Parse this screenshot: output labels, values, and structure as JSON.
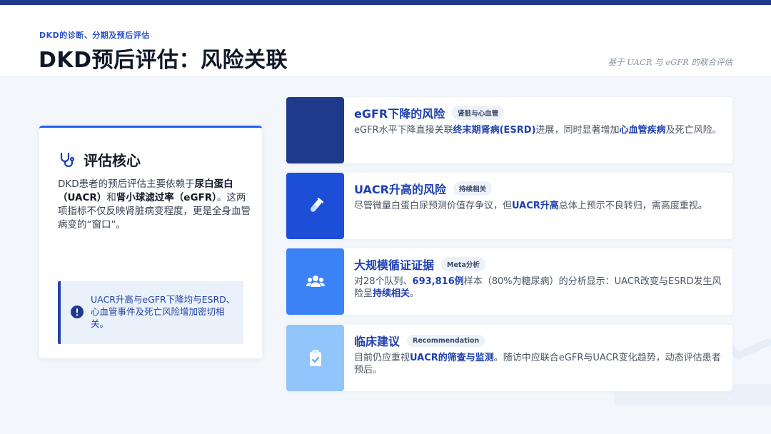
{
  "header": {
    "eyebrow": "DKD的诊断、分期及预后评估",
    "title": "DKD预后评估：风险关联",
    "subtitle": "基于 UACR 与 eGFR 的联合评估"
  },
  "core": {
    "icon": "stethoscope-icon",
    "title": "评估核心",
    "text_1": " DKD患者的预后评估主要依赖于",
    "text_b1": "尿白蛋白（UACR）",
    "text_2": "和",
    "text_b2": "肾小球滤过率（eGFR）",
    "text_3": "。这两项指标不仅反映肾脏病变程度，更是全身血管病变的“窗口”。",
    "callout_icon": "exclamation-circle-icon",
    "callout_text": "UACR升高与eGFR下降均与ESRD、心血管事件及死亡风险增加密切相关。"
  },
  "rows": [
    {
      "icon": "blank-icon",
      "icon_bg": "#1e3a8a",
      "title": "eGFR下降的风险",
      "tag": "肾脏与心血管",
      "t1": "eGFR水平下降直接关联",
      "b1": "终末期肾病(ESRD)",
      "t2": "进展，同时显著增加",
      "b2": "心血管疾病",
      "t3": "及死亡风险。"
    },
    {
      "icon": "test-tube-icon",
      "icon_bg": "#1d4ed8",
      "title": "UACR升高的风险",
      "tag": "持续相关",
      "t1": "尽管微量白蛋白尿预测价值存争议，但",
      "b1": "UACR升高",
      "t2": "总体上预示不良转归，需高度重视。"
    },
    {
      "icon": "users-icon",
      "icon_bg": "#3b82f6",
      "title": "大规模循证证据",
      "tag": "Meta分析",
      "t1": "对28个队列、",
      "b1": "693,816例",
      "t2": "样本（80%为糖尿病）的分析显示：UACR改变与ESRD发生风险呈",
      "b2": "持续相关",
      "t3": "。"
    },
    {
      "icon": "clipboard-check-icon",
      "icon_bg": "#93c5fd",
      "title": "临床建议",
      "tag": "Recommendation",
      "t1": "目前仍应重视",
      "b1": "UACR的筛查与监测",
      "t2": "。随访中应联合eGFR与UACR变化趋势，动态评估患者预后。"
    }
  ]
}
